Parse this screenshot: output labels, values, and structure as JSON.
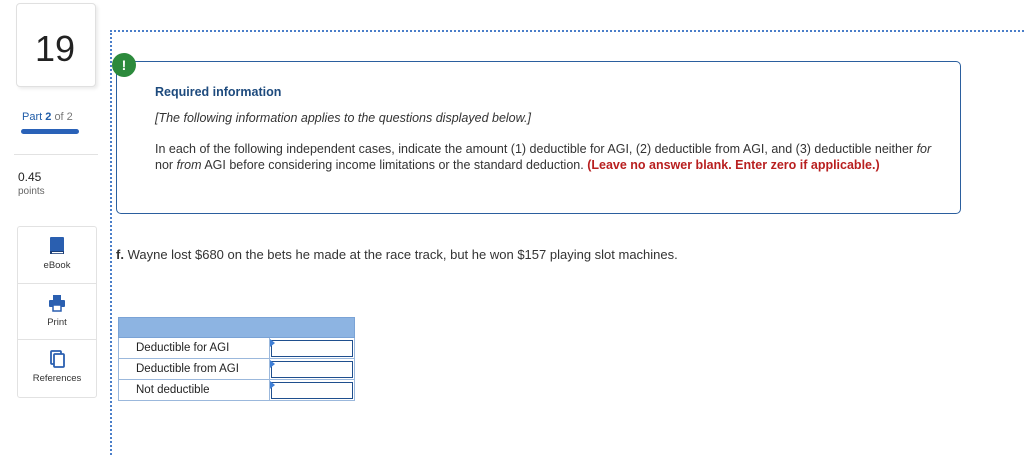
{
  "sidebar": {
    "question_number": "19",
    "part_prefix": "Part",
    "part_current": "2",
    "part_of": "of 2",
    "part_progress": 1.0,
    "points_value": "0.45",
    "points_label": "points",
    "tools": [
      {
        "label": "eBook",
        "icon": "book-icon"
      },
      {
        "label": "Print",
        "icon": "printer-icon"
      },
      {
        "label": "References",
        "icon": "references-icon"
      }
    ]
  },
  "info": {
    "badge": "!",
    "title": "Required information",
    "italic_note": "[The following information applies to the questions displayed below.]",
    "body_part1": "In each of the following independent cases, indicate the amount (1) deductible for AGI, (2) deductible from AGI, and (3) deductible neither ",
    "body_for": "for",
    "body_nor": " nor ",
    "body_from": "from",
    "body_part2": " AGI before considering income limitations or the standard deduction. ",
    "body_red": "(Leave no answer blank. Enter zero if applicable.)"
  },
  "question": {
    "prefix": "f.",
    "text": " Wayne lost $680 on the bets he made at the race track, but he won $157 playing slot machines."
  },
  "answer_table": {
    "rows": [
      {
        "label": "Deductible for AGI",
        "value": ""
      },
      {
        "label": "Deductible from AGI",
        "value": ""
      },
      {
        "label": "Not deductible",
        "value": ""
      }
    ]
  },
  "colors": {
    "accent_blue": "#2a62b8",
    "badge_green": "#2c8a3c",
    "warning_red": "#b81f1f",
    "table_header": "#8db4e2"
  }
}
